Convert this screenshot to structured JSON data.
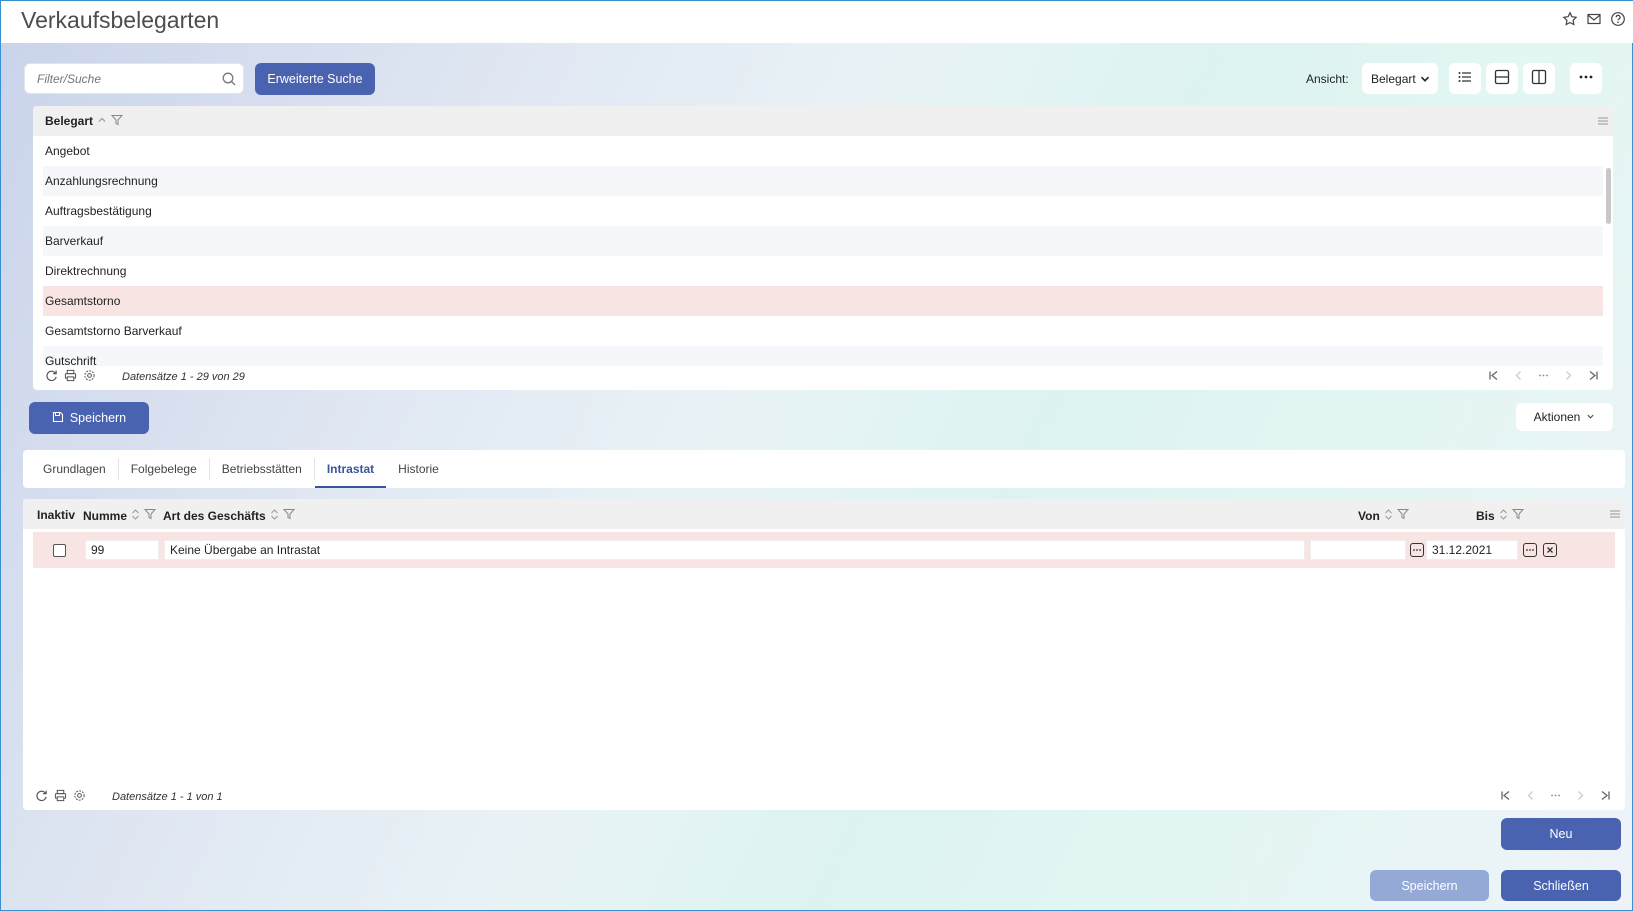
{
  "window": {
    "title": "Verkaufsbelegarten"
  },
  "top_icons": [
    "star-icon",
    "mail-icon",
    "help-icon"
  ],
  "search": {
    "placeholder": "Filter/Suche",
    "advanced_label": "Erweiterte Suche"
  },
  "view": {
    "label": "Ansicht:",
    "selected": "Belegart"
  },
  "grid1": {
    "column": "Belegart",
    "rows": [
      "Angebot",
      "Anzahlungsrechnung",
      "Auftragsbestätigung",
      "Barverkauf",
      "Direktrechnung",
      "Gesamtstorno",
      "Gesamtstorno Barverkauf",
      "Gutschrift"
    ],
    "selected_row": "Gesamtstorno",
    "footer": "Datensätze 1 - 29 von 29"
  },
  "actions": {
    "save_label": "Speichern",
    "aktionen_label": "Aktionen"
  },
  "tabs": [
    {
      "label": "Grundlagen"
    },
    {
      "label": "Folgebelege"
    },
    {
      "label": "Betriebsstätten"
    },
    {
      "label": "Intrastat",
      "active": true
    },
    {
      "label": "Historie"
    }
  ],
  "grid2": {
    "headers": {
      "inaktiv": "Inaktiv",
      "nummer": "Numme",
      "art": "Art des Geschäfts",
      "von": "Von",
      "bis": "Bis"
    },
    "row": {
      "inaktiv": false,
      "nummer": "99",
      "art": "Keine Übergabe an Intrastat",
      "von": "",
      "bis": "31.12.2021"
    },
    "footer": "Datensätze 1 - 1 von 1"
  },
  "buttons": {
    "neu": "Neu",
    "speichern": "Speichern",
    "schliessen": "Schließen"
  },
  "colors": {
    "primary": "#4a63b1",
    "primary_disabled": "#94a9d6",
    "selected_row": "#f8e4e3"
  }
}
